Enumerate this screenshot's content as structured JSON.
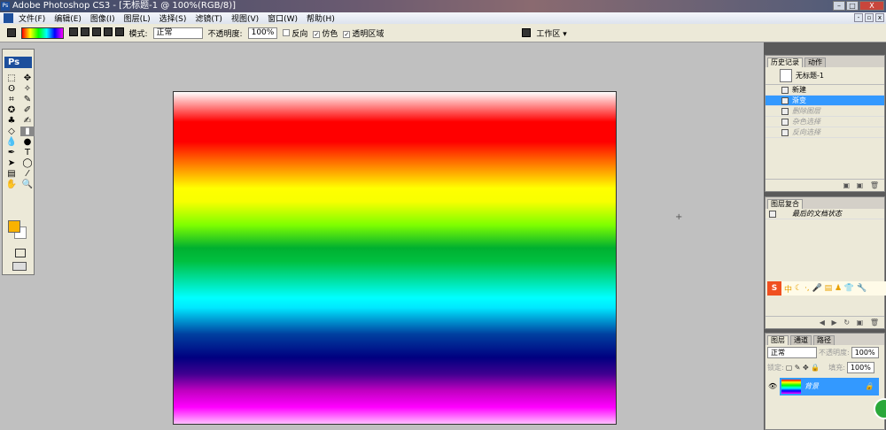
{
  "window": {
    "title": "Adobe Photoshop CS3 - [无标题-1 @ 100%(RGB/8)]"
  },
  "menu": [
    "文件(F)",
    "编辑(E)",
    "图像(I)",
    "图层(L)",
    "选择(S)",
    "滤镜(T)",
    "视图(V)",
    "窗口(W)",
    "帮助(H)"
  ],
  "options": {
    "mode_label": "模式:",
    "mode_value": "正常",
    "opacity_label": "不透明度:",
    "opacity_value": "100%",
    "reverse": "反向",
    "dither": "仿色",
    "transparency": "透明区域",
    "workspace": "工作区 ▾"
  },
  "toolbox": {
    "logo": "Ps",
    "foreground": "#f9b200",
    "background": "#ffffff"
  },
  "history": {
    "tabs": [
      "历史记录",
      "动作"
    ],
    "snapshot": "无标题-1",
    "items": [
      {
        "label": "新建",
        "state": "normal"
      },
      {
        "label": "渐变",
        "state": "selected"
      },
      {
        "label": "删除图层",
        "state": "dimmed"
      },
      {
        "label": "杂色选择",
        "state": "dimmed"
      },
      {
        "label": "反向选择",
        "state": "dimmed"
      }
    ]
  },
  "comps": {
    "tabs": [
      "图层复合"
    ],
    "item": "最后的文档状态"
  },
  "layers": {
    "tabs": [
      "图层",
      "通道",
      "路径"
    ],
    "blend": "正常",
    "opacity_label": "不透明度:",
    "opacity": "100%",
    "lock_label": "锁定:",
    "fill_label": "填充:",
    "fill": "100%",
    "layer_name": "背景"
  },
  "ime": {
    "logo": "S",
    "label": "中"
  }
}
